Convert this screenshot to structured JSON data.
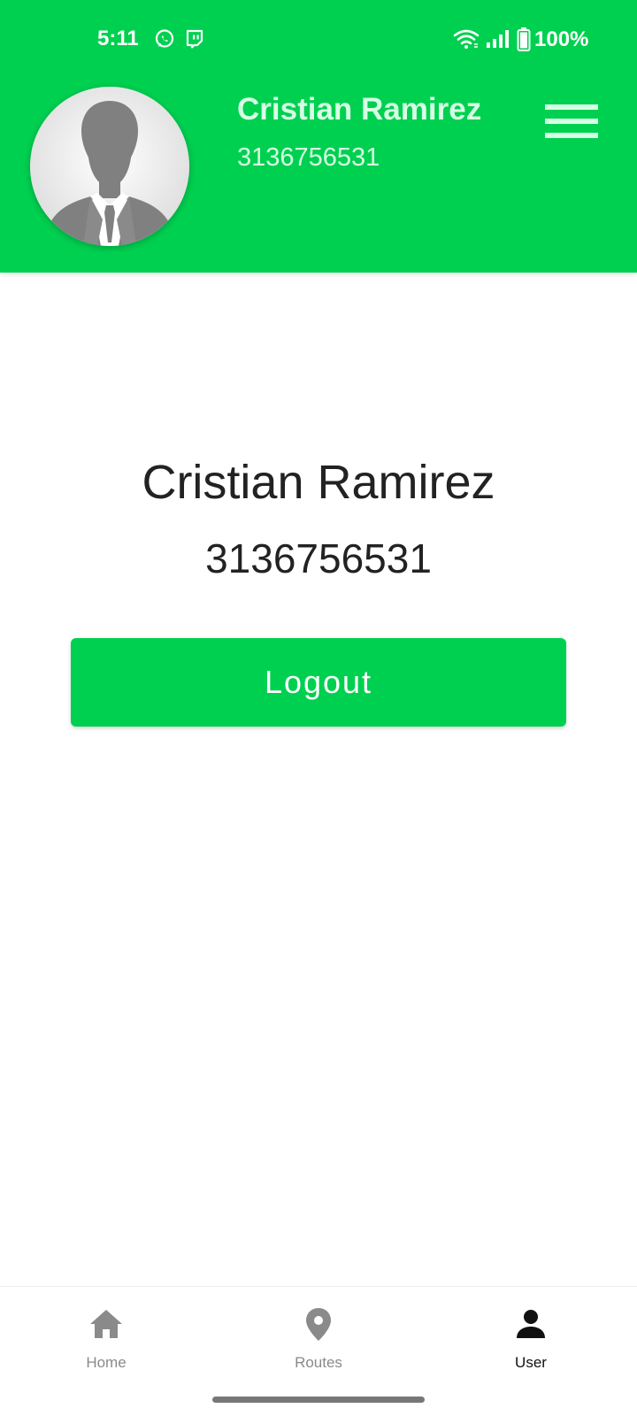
{
  "status_bar": {
    "time": "5:11",
    "battery_percent": "100%",
    "icons": [
      "whatsapp-icon",
      "twitch-icon",
      "wifi-icon",
      "signal-icon",
      "battery-icon"
    ]
  },
  "header": {
    "avatar_icon": "person-silhouette",
    "name": "Cristian Ramirez",
    "phone": "3136756531",
    "menu_icon": "hamburger-menu-icon",
    "background_color": "#00d050"
  },
  "profile": {
    "name": "Cristian Ramirez",
    "phone": "3136756531",
    "logout_label": "Logout"
  },
  "bottom_nav": {
    "items": [
      {
        "label": "Home",
        "icon": "home-icon",
        "active": false
      },
      {
        "label": "Routes",
        "icon": "location-pin-icon",
        "active": false
      },
      {
        "label": "User",
        "icon": "user-icon",
        "active": true
      }
    ]
  },
  "colors": {
    "accent": "#00d050",
    "header_text": "#d6ffe4",
    "body_text": "#222222",
    "nav_inactive": "#8a8a8a",
    "nav_active": "#111111"
  }
}
